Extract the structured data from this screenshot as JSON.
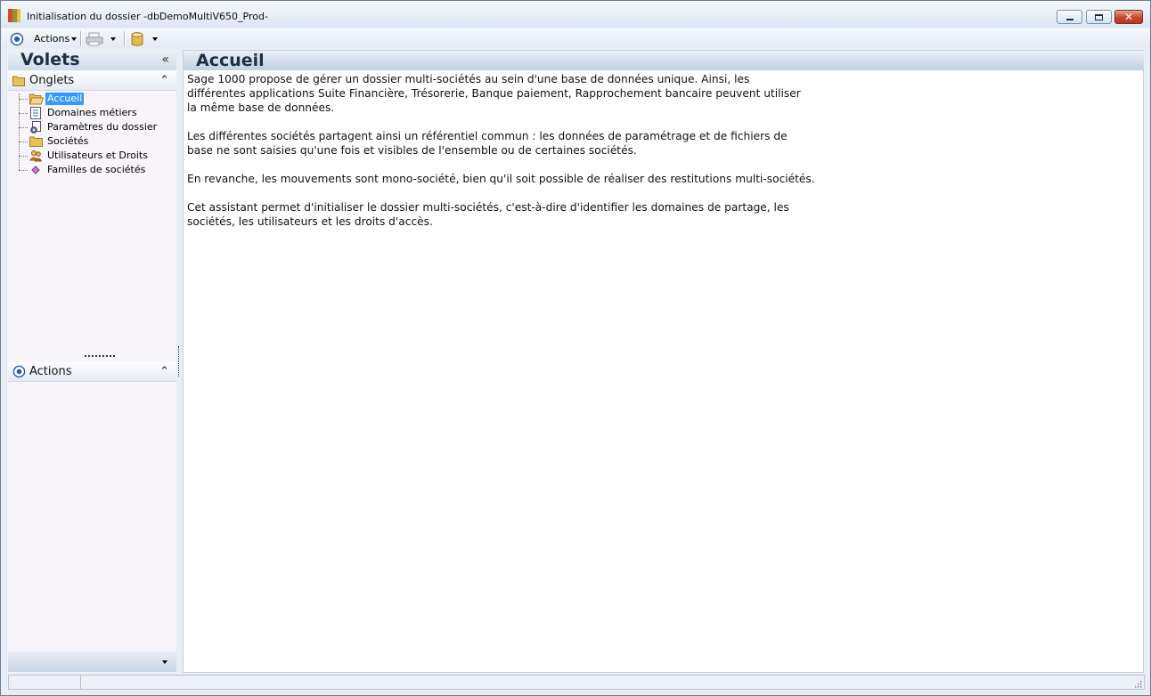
{
  "window": {
    "title": "Initialisation du dossier -dbDemoMultiV650_Prod-"
  },
  "toolbar": {
    "actions_label": "Actions"
  },
  "left_panel": {
    "title": "Volets",
    "onglets_label": "Onglets",
    "actions_label": "Actions",
    "tree_items": [
      {
        "label": "Accueil",
        "icon": "open-folder-icon",
        "selected": true
      },
      {
        "label": "Domaines métiers",
        "icon": "document-list-icon",
        "selected": false
      },
      {
        "label": "Paramètres du dossier",
        "icon": "settings-document-icon",
        "selected": false
      },
      {
        "label": "Sociétés",
        "icon": "folder-icon",
        "selected": false
      },
      {
        "label": "Utilisateurs et Droits",
        "icon": "users-icon",
        "selected": false
      },
      {
        "label": "Familles de sociétés",
        "icon": "diamond-icon",
        "selected": false
      }
    ]
  },
  "main": {
    "title": "Accueil",
    "paragraphs": [
      [
        "Sage 1000 propose de gérer un dossier multi-sociétés au sein d'une base de données unique. Ainsi, les",
        "différentes applications Suite Financière, Trésorerie, Banque paiement, Rapprochement bancaire peuvent utiliser",
        "la même base de données."
      ],
      [
        "Les différentes sociétés partagent ainsi un référentiel commun : les données de paramétrage et de fichiers de",
        "base ne sont saisies qu'une fois et visibles de l'ensemble ou de certaines sociétés."
      ],
      [
        "En revanche, les mouvements sont mono-société, bien qu'il soit possible de réaliser des restitutions multi-sociétés."
      ],
      [
        "Cet assistant permet d'initialiser le dossier multi-sociétés, c'est-à-dire d'identifier les domaines de partage, les",
        "sociétés, les utilisateurs et les droits d'accès."
      ]
    ]
  },
  "colors": {
    "selection": "#3399ff",
    "header_text": "#1f2f45",
    "close_button": "#c6452c"
  }
}
